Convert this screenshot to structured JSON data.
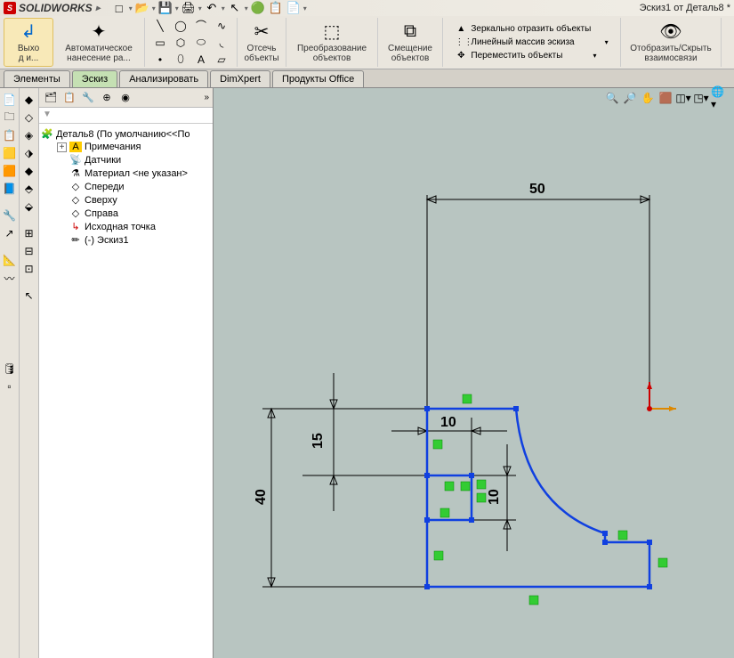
{
  "app": {
    "name": "SOLIDWORKS",
    "title": "Эскиз1 от Деталь8 *"
  },
  "qat": {
    "new": "□",
    "open": "📂",
    "save": "💾",
    "print": "🖨",
    "undo": "↶",
    "select": "↖",
    "rebuild": "🟢",
    "options": "📋",
    "help": "📄"
  },
  "ribbon": {
    "exit": {
      "label": "Выхо\nд и..."
    },
    "autodim": {
      "label": "Автоматическое\nнанесение ра..."
    },
    "trim": {
      "label": "Отсечь\nобъекты"
    },
    "convert": {
      "label": "Преобразование\nобъектов"
    },
    "offset": {
      "label": "Смещение\nобъектов"
    },
    "mirror": {
      "label": "Зеркально отразить объекты"
    },
    "pattern": {
      "label": "Линейный массив эскиза"
    },
    "move": {
      "label": "Переместить объекты"
    },
    "relations": {
      "label": "Отобразить/Скрыть\nвзаимосвязи"
    }
  },
  "tabs": {
    "t1": "Элементы",
    "t2": "Эскиз",
    "t3": "Анализировать",
    "t4": "DimXpert",
    "t5": "Продукты Office"
  },
  "tree": {
    "root": "Деталь8  (По умолчанию<<По",
    "annotations": "Примечания",
    "sensors": "Датчики",
    "material": "Материал <не указан>",
    "front": "Спереди",
    "top": "Сверху",
    "right": "Справа",
    "origin": "Исходная точка",
    "sketch": "(-) Эскиз1"
  },
  "dims": {
    "d50": "50",
    "d40": "40",
    "d15": "15",
    "d10a": "10",
    "d10b": "10"
  }
}
